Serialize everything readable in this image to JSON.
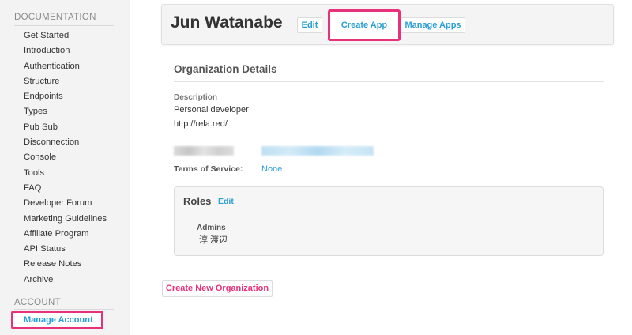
{
  "sidebar": {
    "documentation_heading": "DOCUMENTATION",
    "items": [
      {
        "label": "Get Started"
      },
      {
        "label": "Introduction"
      },
      {
        "label": "Authentication"
      },
      {
        "label": "Structure"
      },
      {
        "label": "Endpoints"
      },
      {
        "label": "Types"
      },
      {
        "label": "Pub Sub"
      },
      {
        "label": "Disconnection"
      },
      {
        "label": "Console"
      },
      {
        "label": "Tools"
      },
      {
        "label": "FAQ"
      },
      {
        "label": "Developer Forum"
      },
      {
        "label": "Marketing Guidelines"
      },
      {
        "label": "Affiliate Program"
      },
      {
        "label": "API Status"
      },
      {
        "label": "Release Notes"
      },
      {
        "label": "Archive"
      }
    ],
    "account_heading": "ACCOUNT",
    "manage_account_label": "Manage Account"
  },
  "header": {
    "title": "Jun Watanabe",
    "edit_label": "Edit",
    "create_app_label": "Create App",
    "manage_apps_label": "Manage Apps"
  },
  "organization": {
    "section_title": "Organization Details",
    "description_label": "Description",
    "description_lines": [
      "Personal developer",
      "http://rela.red/"
    ],
    "tos_label": "Terms of Service:",
    "tos_value": "None"
  },
  "roles": {
    "title": "Roles",
    "edit_label": "Edit",
    "admins_label": "Admins",
    "admin_name": "淳 渡辺"
  },
  "footer": {
    "create_org_label": "Create New Organization"
  },
  "colors": {
    "accent_link": "#2a9fd6",
    "highlight": "#e9307a",
    "sidebar_bg": "#f3f3f4"
  }
}
